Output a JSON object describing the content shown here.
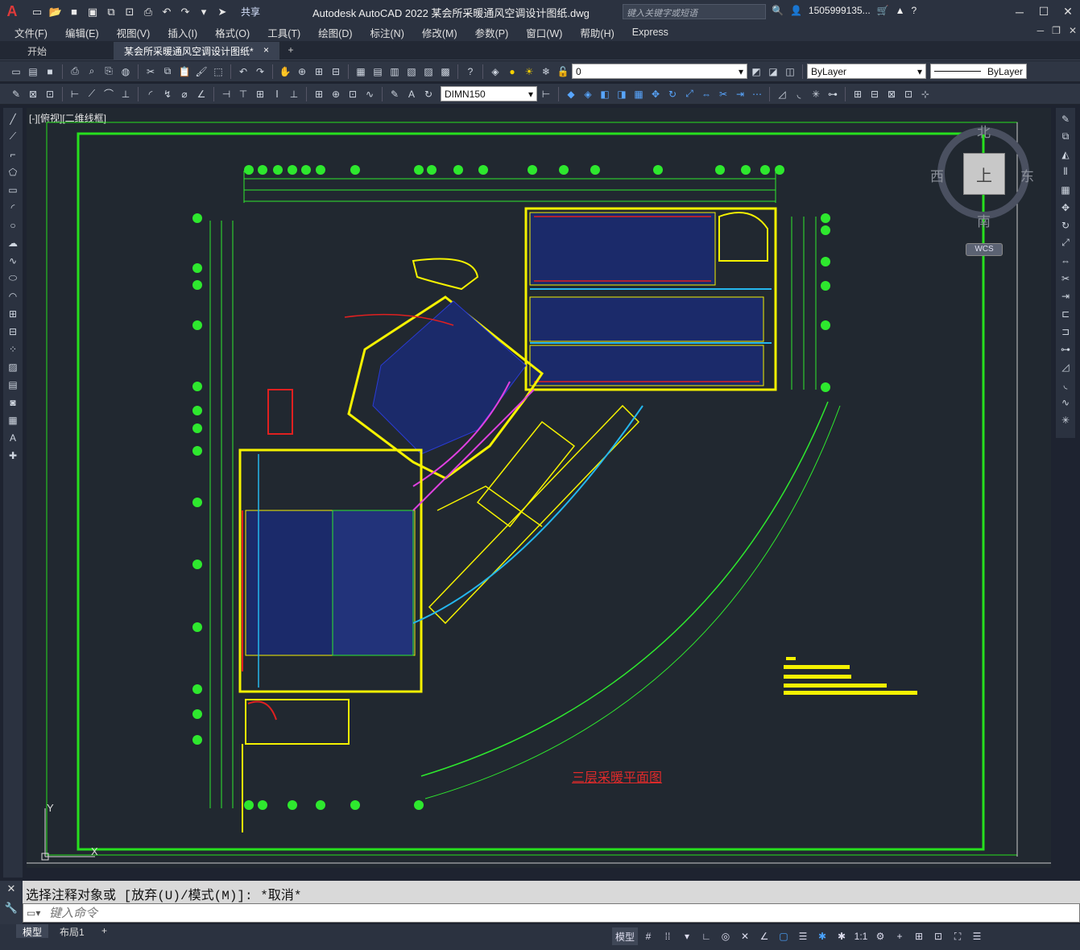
{
  "app": {
    "title": "Autodesk AutoCAD 2022    某会所采暖通风空调设计图纸.dwg",
    "logo": "A",
    "share_label": "共享",
    "search_placeholder": "键入关键字或短语",
    "user": "1505999135...",
    "help": "?"
  },
  "menu": [
    "文件(F)",
    "编辑(E)",
    "视图(V)",
    "插入(I)",
    "格式(O)",
    "工具(T)",
    "绘图(D)",
    "标注(N)",
    "修改(M)",
    "参数(P)",
    "窗口(W)",
    "帮助(H)",
    "Express"
  ],
  "tabs": {
    "start": "开始",
    "active": "某会所采暖通风空调设计图纸*",
    "close": "×",
    "add": "+"
  },
  "toolbar": {
    "layer_value": "0",
    "color_value": "ByLayer",
    "linetype_value": "ByLayer",
    "dimstyle_value": "DIMN150"
  },
  "canvas": {
    "view_label": "[-][俯视][二维线框]",
    "viewcube": {
      "top": "上",
      "north": "北",
      "south": "南",
      "east": "东",
      "west": "西",
      "wcs": "WCS"
    },
    "drawing_title": "三层采暖平面图",
    "ucs_x": "X",
    "ucs_y": "Y",
    "colors": {
      "border": "#27e01e",
      "walls": "#f5f200",
      "ducts": "#2a3bd6",
      "pipes": "#e02020",
      "dims": "#2ee82e",
      "cyan": "#25b7ee",
      "magenta": "#e040e0",
      "title": "#e02a2a"
    }
  },
  "command": {
    "history": "选择注释对象或 [放弃(U)/模式(M)]: *取消*",
    "placeholder": "键入命令"
  },
  "status": {
    "model_tab": "模型",
    "layout_tab": "布局1",
    "add": "+",
    "model_btn": "模型",
    "scale": "1:1"
  }
}
